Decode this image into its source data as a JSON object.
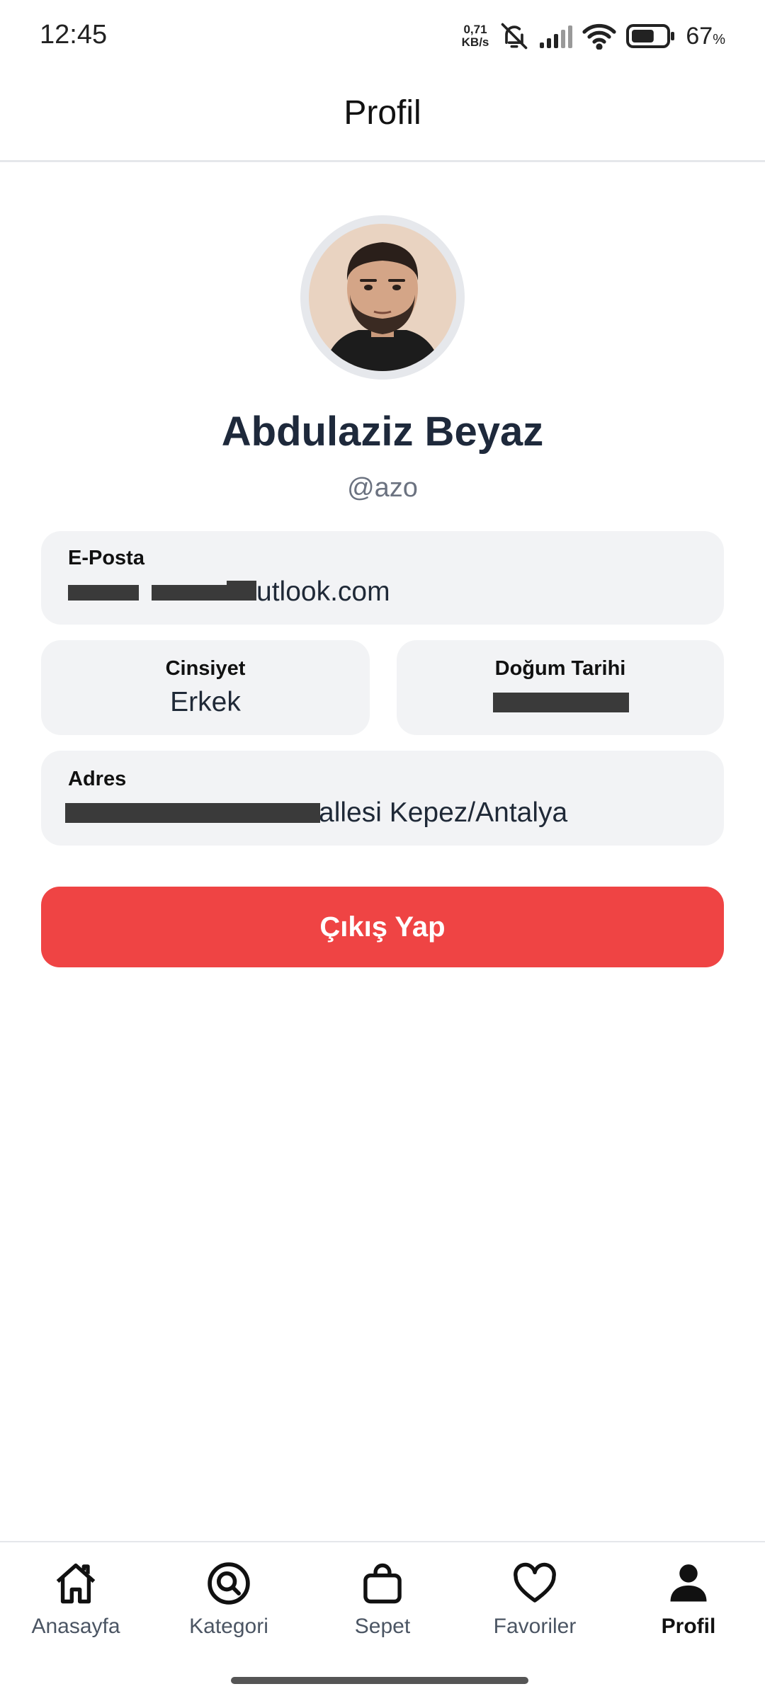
{
  "status_bar": {
    "time": "12:45",
    "net_speed_value": "0,71",
    "net_speed_unit": "KB/s",
    "battery_percent": "67",
    "battery_level": 0.67,
    "icons": [
      "mute-bell-icon",
      "signal-icon",
      "wifi-icon",
      "battery-icon"
    ]
  },
  "header": {
    "title": "Profil"
  },
  "profile": {
    "name": "Abdulaziz Beyaz",
    "username": "@azo"
  },
  "fields": {
    "email": {
      "label": "E-Posta",
      "value": "utlook.com"
    },
    "gender": {
      "label": "Cinsiyet",
      "value": "Erkek"
    },
    "birth_date": {
      "label": "Doğum Tarihi",
      "value": ""
    },
    "address": {
      "label": "Adres",
      "value": "allesi Kepez/Antalya"
    }
  },
  "actions": {
    "logout_label": "Çıkış Yap"
  },
  "bottom_nav": {
    "items": [
      {
        "label": "Anasayfa",
        "icon": "home-icon"
      },
      {
        "label": "Kategori",
        "icon": "search-icon"
      },
      {
        "label": "Sepet",
        "icon": "bag-icon"
      },
      {
        "label": "Favoriler",
        "icon": "heart-icon"
      },
      {
        "label": "Profil",
        "icon": "user-icon"
      }
    ],
    "active_index": 4
  },
  "colors": {
    "accent_red": "#ef4444",
    "card_bg": "#f2f3f5",
    "text_dark": "#1e293b"
  }
}
